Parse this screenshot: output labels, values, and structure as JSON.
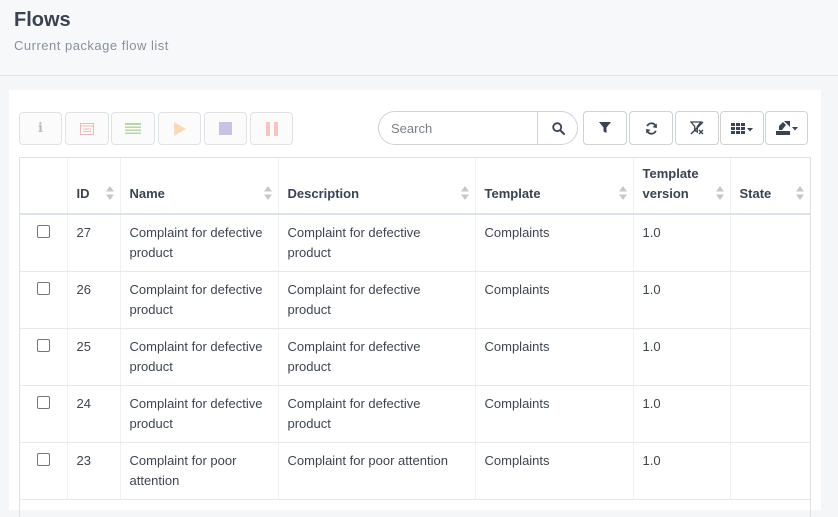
{
  "header": {
    "title": "Flows",
    "subtitle": "Current package flow list"
  },
  "toolbar": {
    "left_buttons": [
      "info-icon",
      "form-icon",
      "list-icon",
      "play-icon",
      "stop-icon",
      "pause-icon"
    ],
    "colors": {
      "play": "#f6b26b",
      "stop": "#8e7cc3",
      "pause": "#e8a09a",
      "list": "#6aa84f",
      "form": "#e06666"
    }
  },
  "search": {
    "placeholder": "Search"
  },
  "right_buttons": [
    "filter-icon",
    "refresh-icon",
    "clear-filter-icon",
    "columns-icon",
    "export-icon"
  ],
  "table": {
    "columns": [
      "ID",
      "Name",
      "Description",
      "Template",
      "Template version",
      "State"
    ],
    "rows": [
      {
        "id": "27",
        "name": "Complaint for defective product",
        "description": "Complaint for defective product",
        "template": "Complaints",
        "version": "1.0",
        "state": ""
      },
      {
        "id": "26",
        "name": "Complaint for defective product",
        "description": "Complaint for defective product",
        "template": "Complaints",
        "version": "1.0",
        "state": ""
      },
      {
        "id": "25",
        "name": "Complaint for defective product",
        "description": "Complaint for defective product",
        "template": "Complaints",
        "version": "1.0",
        "state": ""
      },
      {
        "id": "24",
        "name": "Complaint for defective product",
        "description": "Complaint for defective product",
        "template": "Complaints",
        "version": "1.0",
        "state": ""
      },
      {
        "id": "23",
        "name": "Complaint for poor attention",
        "description": "Complaint for poor attention",
        "template": "Complaints",
        "version": "1.0",
        "state": ""
      }
    ]
  }
}
